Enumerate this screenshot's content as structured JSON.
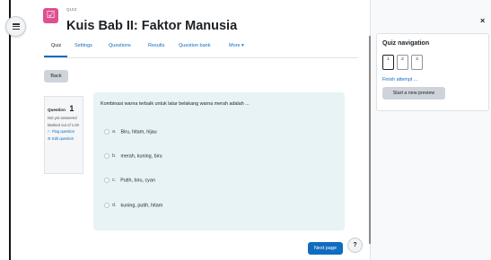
{
  "header": {
    "kicker": "QUIZ",
    "title": "Kuis Bab II: Faktor Manusia"
  },
  "tabs": [
    {
      "label": "Quiz"
    },
    {
      "label": "Settings"
    },
    {
      "label": "Questions"
    },
    {
      "label": "Results"
    },
    {
      "label": "Question bank"
    },
    {
      "label": "More ▾"
    }
  ],
  "back_button": "Back",
  "question_info": {
    "label": "Question",
    "number": "1",
    "status": "Not yet answered",
    "marked": "Marked out of 1.00",
    "flag": "Flag question",
    "edit": "Edit question"
  },
  "question": {
    "text": "Kombinasi warna terbaik untuk latar belakang warna merah adalah ...",
    "answers": [
      {
        "letter": "a.",
        "text": "Biru, hitam, hijau"
      },
      {
        "letter": "b.",
        "text": "merah, kuning, biru"
      },
      {
        "letter": "c.",
        "text": "Putih, biru, cyan"
      },
      {
        "letter": "d.",
        "text": "kuning, putih, hitam"
      }
    ]
  },
  "next_button": "Next page",
  "help_label": "?",
  "close_label": "×",
  "nav_panel": {
    "title": "Quiz navigation",
    "buttons": [
      "1",
      "2",
      "3"
    ],
    "finish": "Finish attempt ...",
    "preview": "Start a new preview"
  },
  "colors": {
    "accent": "#0f6cbf",
    "quiz_icon": "#e0508e",
    "form_bg": "#e7f3f5"
  }
}
